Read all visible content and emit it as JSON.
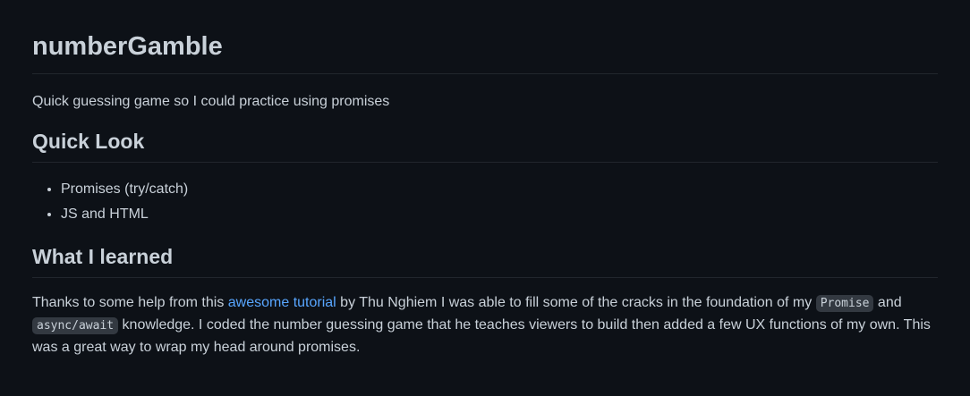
{
  "readme": {
    "title": "numberGamble",
    "description": "Quick guessing game so I could practice using promises",
    "section_quick_look": {
      "heading": "Quick Look",
      "items": [
        "Promises (try/catch)",
        "JS and HTML"
      ]
    },
    "section_learned": {
      "heading": "What I learned",
      "text_1": "Thanks to some help from this ",
      "link_text": "awesome tutorial",
      "text_2": " by Thu Nghiem I was able to fill some of the cracks in the foundation of my ",
      "code_1": "Promise",
      "text_3": " and ",
      "code_2": "async/await",
      "text_4": " knowledge. I coded the number guessing game that he teaches viewers to build then added a few UX functions of my own. This was a great way to wrap my head around promises."
    }
  },
  "colors": {
    "background": "#0d1117",
    "text": "#c9d1d9",
    "link": "#58a6ff",
    "divider": "#21262d"
  }
}
